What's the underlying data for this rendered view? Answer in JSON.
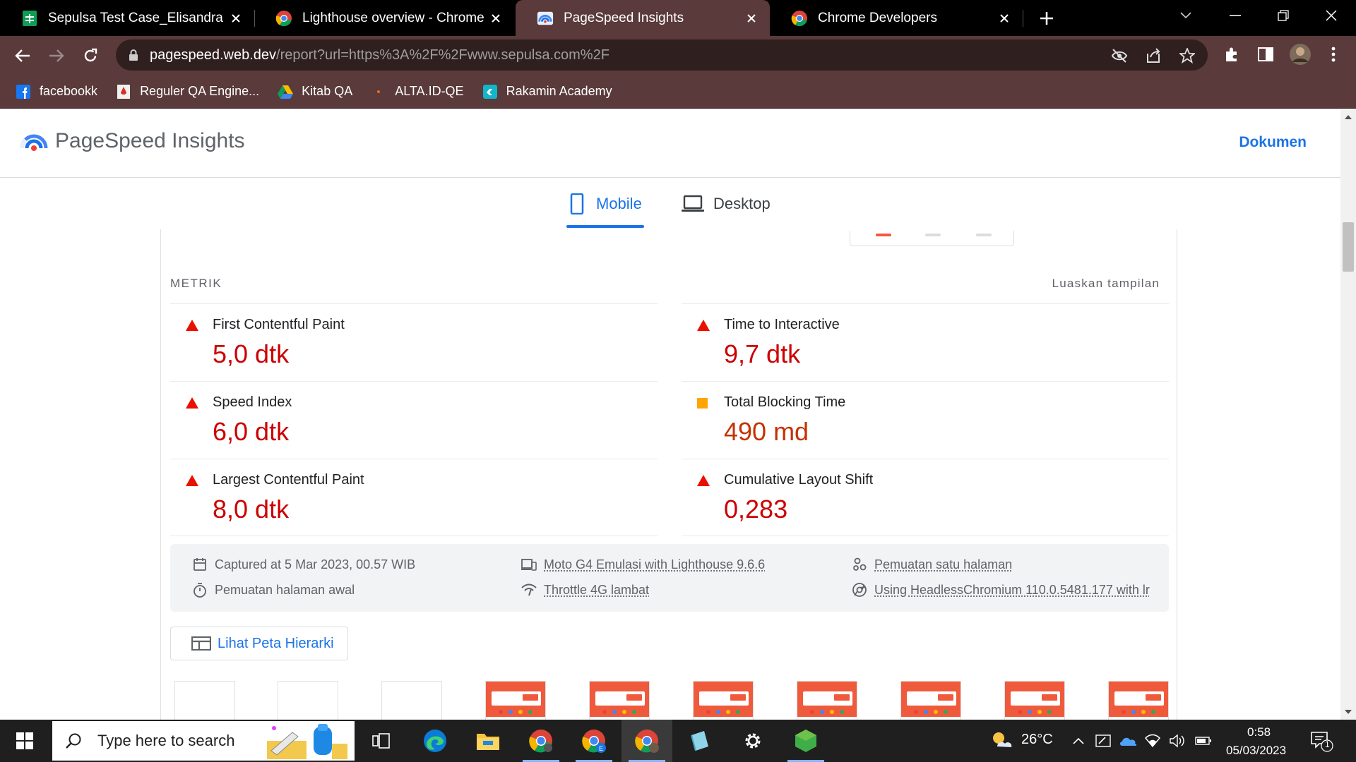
{
  "tabs": [
    {
      "title": "Sepulsa Test Case_Elisandra .xlsx",
      "icon": "sheets-icon",
      "active": false
    },
    {
      "title": "Lighthouse overview - Chrome D",
      "icon": "chrome-icon",
      "active": false
    },
    {
      "title": "PageSpeed Insights",
      "icon": "pagespeed-icon",
      "active": true
    },
    {
      "title": "Chrome Developers",
      "icon": "chrome-icon",
      "active": false
    }
  ],
  "address_bar": {
    "host": "pagespeed.web.dev",
    "path": "/report?url=https%3A%2F%2Fwww.sepulsa.com%2F"
  },
  "bookmarks": [
    {
      "label": "facebookk",
      "icon": "facebook-icon"
    },
    {
      "label": "Reguler QA Engine...",
      "icon": "bookmark-red-icon"
    },
    {
      "label": "Kitab QA",
      "icon": "google-drive-icon"
    },
    {
      "label": "ALTA.ID-QE",
      "icon": "alta-icon"
    },
    {
      "label": "Rakamin Academy",
      "icon": "rakamin-icon"
    }
  ],
  "header": {
    "title": "PageSpeed Insights",
    "docs_link": "Dokumen"
  },
  "device_tabs": {
    "mobile": "Mobile",
    "desktop": "Desktop"
  },
  "metrics_section": {
    "label": "METRIK",
    "expand": "Luaskan tampilan",
    "items": [
      {
        "name": "First Contentful Paint",
        "value": "5,0 dtk",
        "status": "poor"
      },
      {
        "name": "Time to Interactive",
        "value": "9,7 dtk",
        "status": "poor"
      },
      {
        "name": "Speed Index",
        "value": "6,0 dtk",
        "status": "poor"
      },
      {
        "name": "Total Blocking Time",
        "value": "490 md",
        "status": "average"
      },
      {
        "name": "Largest Contentful Paint",
        "value": "8,0 dtk",
        "status": "poor"
      },
      {
        "name": "Cumulative Layout Shift",
        "value": "0,283",
        "status": "poor"
      }
    ]
  },
  "capture_info": {
    "captured_at": "Captured at 5 Mar 2023, 00.57 WIB",
    "initial_load": "Pemuatan halaman awal",
    "device": "Moto G4 Emulasi with Lighthouse 9.6.6",
    "throttle": "Throttle 4G lambat",
    "single_page": "Pemuatan satu halaman",
    "browser": "Using HeadlessChromium 110.0.5481.177 with lr"
  },
  "tree_button": "Lihat Peta Hierarki",
  "filmstrip": {
    "frames": [
      "blank",
      "blank",
      "blank",
      "shot",
      "shot",
      "shot",
      "shot",
      "shot",
      "shot",
      "shot"
    ]
  },
  "taskbar": {
    "search_placeholder": "Type here to search",
    "weather": "26°C",
    "time": "0:58",
    "date": "05/03/2023",
    "notification_count": "1"
  },
  "colors": {
    "poor": "#cc0000",
    "poor_icon": "#eb0f00",
    "average": "#c33300",
    "average_icon": "#ffa400",
    "link": "#1a73e8",
    "tab_bar": "#5a3a3a"
  }
}
